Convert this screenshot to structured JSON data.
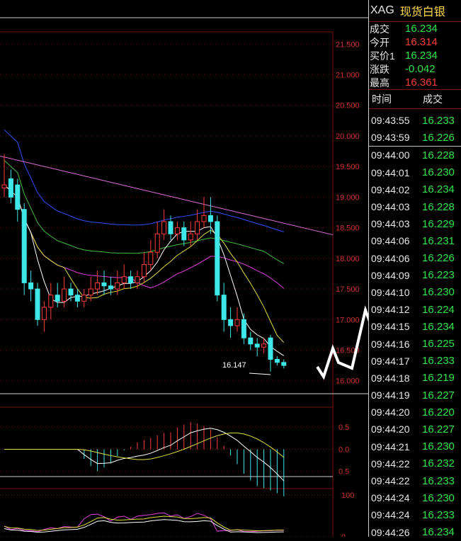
{
  "quote": {
    "symbol": "XAG",
    "name": "现货白银",
    "rows": [
      {
        "label": "成交",
        "value": "16.234",
        "color": "#2ee64a"
      },
      {
        "label": "今开",
        "value": "16.314",
        "color": "#ff3b3b"
      },
      {
        "label": "买价1",
        "value": "16.234",
        "color": "#2ee64a"
      },
      {
        "label": "涨跌",
        "value": "-0.042",
        "color": "#2ee64a"
      },
      {
        "label": "最高",
        "value": "16.361",
        "color": "#ff3b3b"
      }
    ]
  },
  "ticks": {
    "header_time": "时间",
    "header_price": "成交",
    "group1": [
      {
        "time": "09:43:55",
        "price": "16.233"
      },
      {
        "time": "09:43:59",
        "price": "16.226"
      }
    ],
    "group2": [
      {
        "time": "09:44:00",
        "price": "16.228"
      },
      {
        "time": "09:44:01",
        "price": "16.230"
      },
      {
        "time": "09:44:02",
        "price": "16.234"
      },
      {
        "time": "09:44:03",
        "price": "16.228"
      },
      {
        "time": "09:44:03",
        "price": "16.229"
      },
      {
        "time": "09:44:06",
        "price": "16.231"
      },
      {
        "time": "09:44:06",
        "price": "16.226"
      },
      {
        "time": "09:44:09",
        "price": "16.223"
      },
      {
        "time": "09:44:10",
        "price": "16.230"
      },
      {
        "time": "09:44:12",
        "price": "16.224"
      },
      {
        "time": "09:44:15",
        "price": "16.234"
      },
      {
        "time": "09:44:16",
        "price": "16.225"
      },
      {
        "time": "09:44:17",
        "price": "16.233"
      },
      {
        "time": "09:44:18",
        "price": "16.219"
      },
      {
        "time": "09:44:19",
        "price": "16.227"
      },
      {
        "time": "09:44:20",
        "price": "16.220"
      },
      {
        "time": "09:44:20",
        "price": "16.227"
      },
      {
        "time": "09:44:21",
        "price": "16.230"
      },
      {
        "time": "09:44:22",
        "price": "16.232"
      },
      {
        "time": "09:44:22",
        "price": "16.233"
      },
      {
        "time": "09:44:24",
        "price": "16.230"
      },
      {
        "time": "09:44:24",
        "price": "16.233"
      },
      {
        "time": "09:44:26",
        "price": "16.234"
      }
    ]
  },
  "colors": {
    "up": "#ff3b3b",
    "down": "#3ee8e8",
    "grid": "#7a1010",
    "axis_text": "#d03030",
    "ma5": "#ffffff",
    "ma10": "#e0e040",
    "ma20": "#e040e0",
    "ma40": "#40c040",
    "ma60": "#3050ff",
    "trendline": "#e070e0",
    "annotation": "#ffffff"
  },
  "chart_data": {
    "type": "candlestick",
    "ylim": [
      15.8,
      21.7
    ],
    "y_ticks": [
      "21.500",
      "21.000",
      "20.500",
      "20.000",
      "19.500",
      "19.000",
      "18.500",
      "18.000",
      "17.500",
      "17.000",
      "16.500",
      "16.000"
    ],
    "candles": [
      [
        19.15,
        19.2,
        19.7,
        19.0
      ],
      [
        19.3,
        19.0,
        19.45,
        18.9
      ],
      [
        19.2,
        18.8,
        19.3,
        18.6
      ],
      [
        18.8,
        17.6,
        18.9,
        17.4
      ],
      [
        17.6,
        17.5,
        17.8,
        17.3
      ],
      [
        17.5,
        17.0,
        17.6,
        16.9
      ],
      [
        17.0,
        17.2,
        17.3,
        16.8
      ],
      [
        17.2,
        17.4,
        17.6,
        17.0
      ],
      [
        17.4,
        17.3,
        17.6,
        17.2
      ],
      [
        17.3,
        17.5,
        17.7,
        17.2
      ],
      [
        17.5,
        17.4,
        17.6,
        17.3
      ],
      [
        17.4,
        17.3,
        17.5,
        17.2
      ],
      [
        17.3,
        17.4,
        17.5,
        17.2
      ],
      [
        17.4,
        17.5,
        17.7,
        17.3
      ],
      [
        17.5,
        17.6,
        17.8,
        17.4
      ],
      [
        17.6,
        17.55,
        17.8,
        17.4
      ],
      [
        17.55,
        17.5,
        17.7,
        17.4
      ],
      [
        17.5,
        17.6,
        17.8,
        17.4
      ],
      [
        17.6,
        17.7,
        17.9,
        17.5
      ],
      [
        17.7,
        17.6,
        17.8,
        17.5
      ],
      [
        17.6,
        17.7,
        17.8,
        17.5
      ],
      [
        17.7,
        17.9,
        18.1,
        17.6
      ],
      [
        17.9,
        18.1,
        18.3,
        17.8
      ],
      [
        18.1,
        18.4,
        18.6,
        18.0
      ],
      [
        18.4,
        18.6,
        18.8,
        18.3
      ],
      [
        18.6,
        18.4,
        18.7,
        18.3
      ],
      [
        18.4,
        18.5,
        18.6,
        18.3
      ],
      [
        18.5,
        18.3,
        18.6,
        18.2
      ],
      [
        18.3,
        18.4,
        18.6,
        18.2
      ],
      [
        18.4,
        18.6,
        18.8,
        18.3
      ],
      [
        18.6,
        18.7,
        19.0,
        18.5
      ],
      [
        18.7,
        18.6,
        19.0,
        18.4
      ],
      [
        18.6,
        17.4,
        18.7,
        17.3
      ],
      [
        17.4,
        17.0,
        17.6,
        16.8
      ],
      [
        17.0,
        16.9,
        17.2,
        16.7
      ],
      [
        16.9,
        17.0,
        17.2,
        16.8
      ],
      [
        17.0,
        16.7,
        17.1,
        16.6
      ],
      [
        16.7,
        16.6,
        16.8,
        16.5
      ],
      [
        16.6,
        16.55,
        16.7,
        16.4
      ],
      [
        16.55,
        16.6,
        16.7,
        16.45
      ],
      [
        16.7,
        16.35,
        16.75,
        16.15
      ],
      [
        16.35,
        16.3,
        16.4,
        16.25
      ],
      [
        16.3,
        16.25,
        16.35,
        16.2
      ]
    ],
    "trendline": [
      [
        18.98,
        -12
      ],
      [
        18.57,
        48
      ]
    ],
    "annotation": {
      "label": "16.147",
      "value": 16.147
    },
    "macd": {
      "ylim": [
        -0.6,
        0.95
      ],
      "y_ticks": [
        "0.5",
        "0.0",
        "0.5"
      ]
    },
    "kdj": {
      "ylim": [
        0,
        115
      ],
      "y_ticks": [
        "100",
        "0"
      ]
    }
  }
}
